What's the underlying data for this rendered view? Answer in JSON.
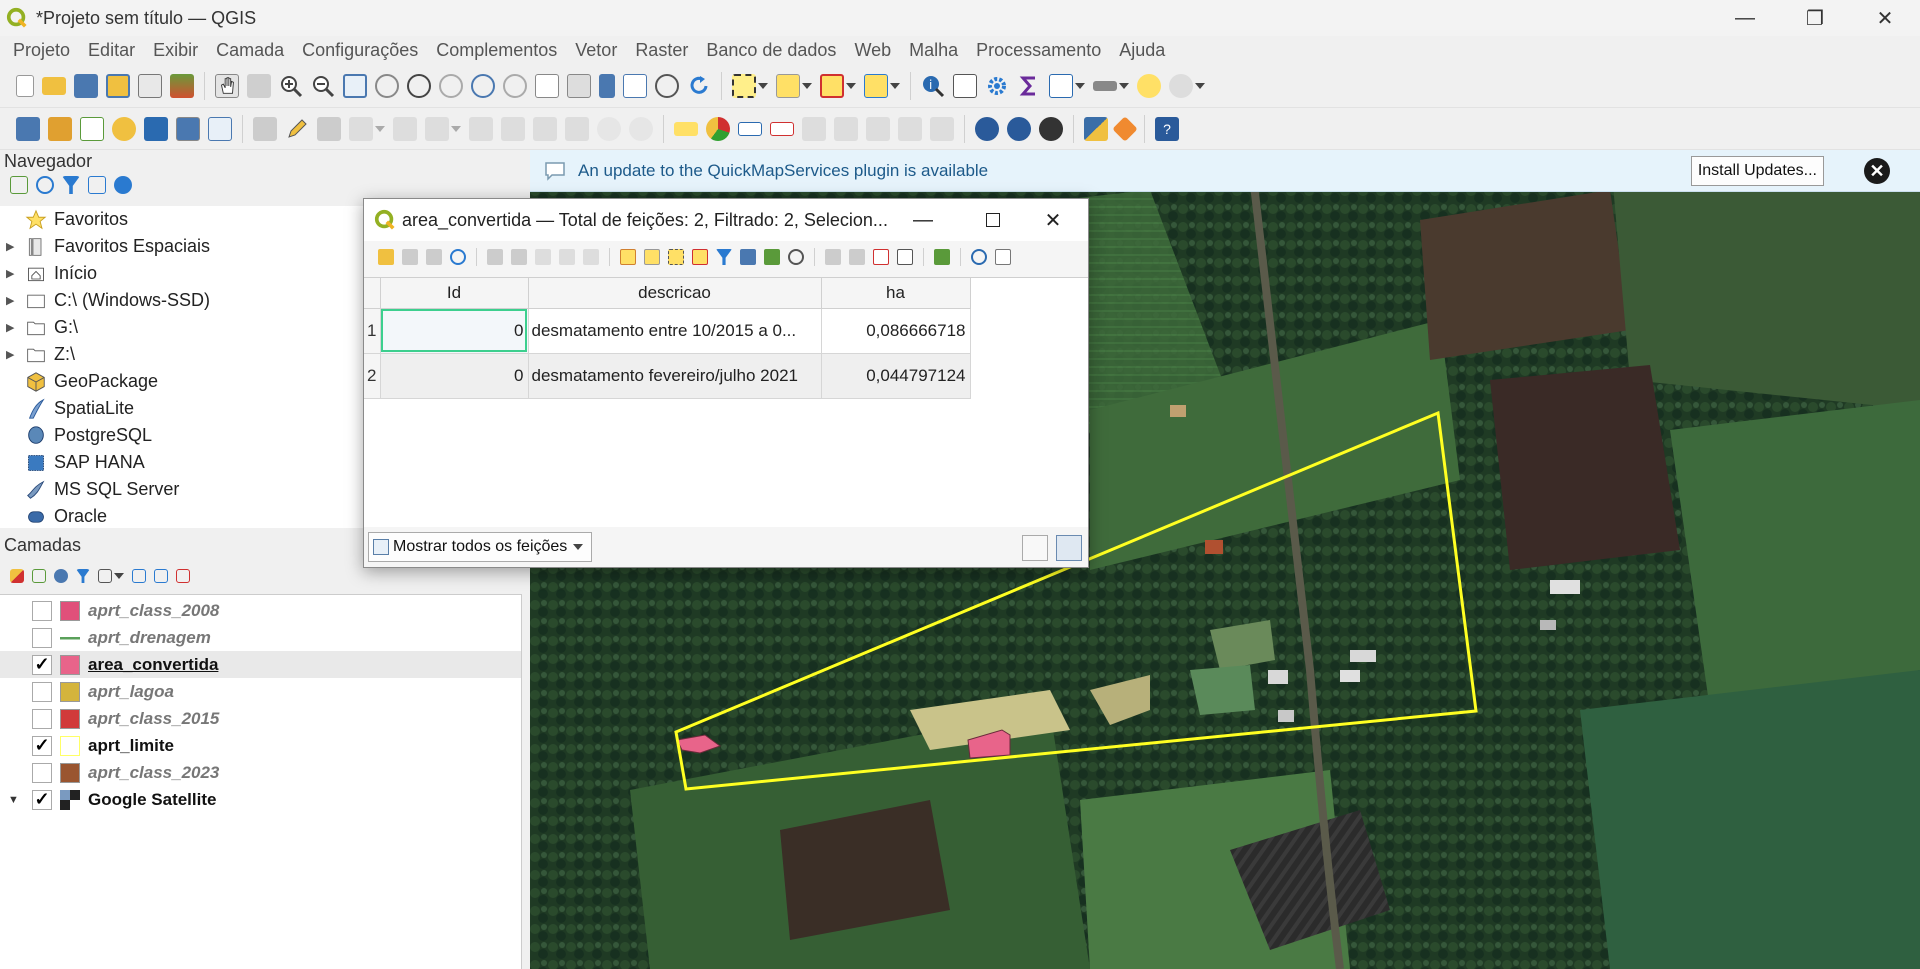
{
  "window": {
    "title": "*Projeto sem título — QGIS",
    "minimize": "—",
    "maximize": "❐",
    "close": "✕"
  },
  "menu": [
    "Projeto",
    "Editar",
    "Exibir",
    "Camada",
    "Configurações",
    "Complementos",
    "Vetor",
    "Raster",
    "Banco de dados",
    "Web",
    "Malha",
    "Processamento",
    "Ajuda"
  ],
  "browser": {
    "title": "Navegador",
    "items": [
      {
        "label": "Favoritos",
        "icon": "star-icon",
        "expandable": false
      },
      {
        "label": "Favoritos Espaciais",
        "icon": "spatial-bookmark-icon",
        "expandable": true
      },
      {
        "label": "Início",
        "icon": "home-icon",
        "expandable": true
      },
      {
        "label": "C:\\ (Windows-SSD)",
        "icon": "drive-icon",
        "expandable": true
      },
      {
        "label": "G:\\",
        "icon": "folder-icon",
        "expandable": true
      },
      {
        "label": "Z:\\",
        "icon": "folder-icon",
        "expandable": true
      },
      {
        "label": "GeoPackage",
        "icon": "geopackage-icon",
        "expandable": false
      },
      {
        "label": "SpatiaLite",
        "icon": "spatialite-icon",
        "expandable": false
      },
      {
        "label": "PostgreSQL",
        "icon": "postgresql-icon",
        "expandable": false
      },
      {
        "label": "SAP HANA",
        "icon": "sap-hana-icon",
        "expandable": false
      },
      {
        "label": "MS SQL Server",
        "icon": "mssql-icon",
        "expandable": false
      },
      {
        "label": "Oracle",
        "icon": "oracle-icon",
        "expandable": false
      }
    ]
  },
  "layers": {
    "title": "Camadas",
    "items": [
      {
        "name": "aprt_class_2008",
        "checked": false,
        "color": "#e0507a",
        "type": "fill"
      },
      {
        "name": "aprt_drenagem",
        "checked": false,
        "color": "#5aa05a",
        "type": "line"
      },
      {
        "name": "area_convertida",
        "checked": true,
        "color": "#e8648a",
        "type": "fill",
        "selected": true
      },
      {
        "name": "aprt_lagoa",
        "checked": false,
        "color": "#d4b43c",
        "type": "fill"
      },
      {
        "name": "aprt_class_2015",
        "checked": false,
        "color": "#d13a3a",
        "type": "fill"
      },
      {
        "name": "aprt_limite",
        "checked": true,
        "color": "#ffff66",
        "type": "outline"
      },
      {
        "name": "aprt_class_2023",
        "checked": false,
        "color": "#9a5530",
        "type": "fill"
      },
      {
        "name": "Google Satellite",
        "checked": true,
        "color": "#333333",
        "type": "raster",
        "expanded": true
      }
    ]
  },
  "banner": {
    "message": "An update to the QuickMapServices plugin is available",
    "button": "Install Updates...",
    "close": "✕"
  },
  "attribute_table": {
    "title": "area_convertida — Total de feições: 2, Filtrado: 2, Selecion...",
    "columns": [
      "Id",
      "descricao",
      "ha"
    ],
    "rows": [
      {
        "row": "1",
        "Id": "0",
        "descricao": "desmatamento entre 10/2015 a 0...",
        "ha": "0,086666718"
      },
      {
        "row": "2",
        "Id": "0",
        "descricao": "desmatamento fevereiro/julho 2021",
        "ha": "0,044797124"
      }
    ],
    "filter_button": "Mostrar todos os feições"
  }
}
